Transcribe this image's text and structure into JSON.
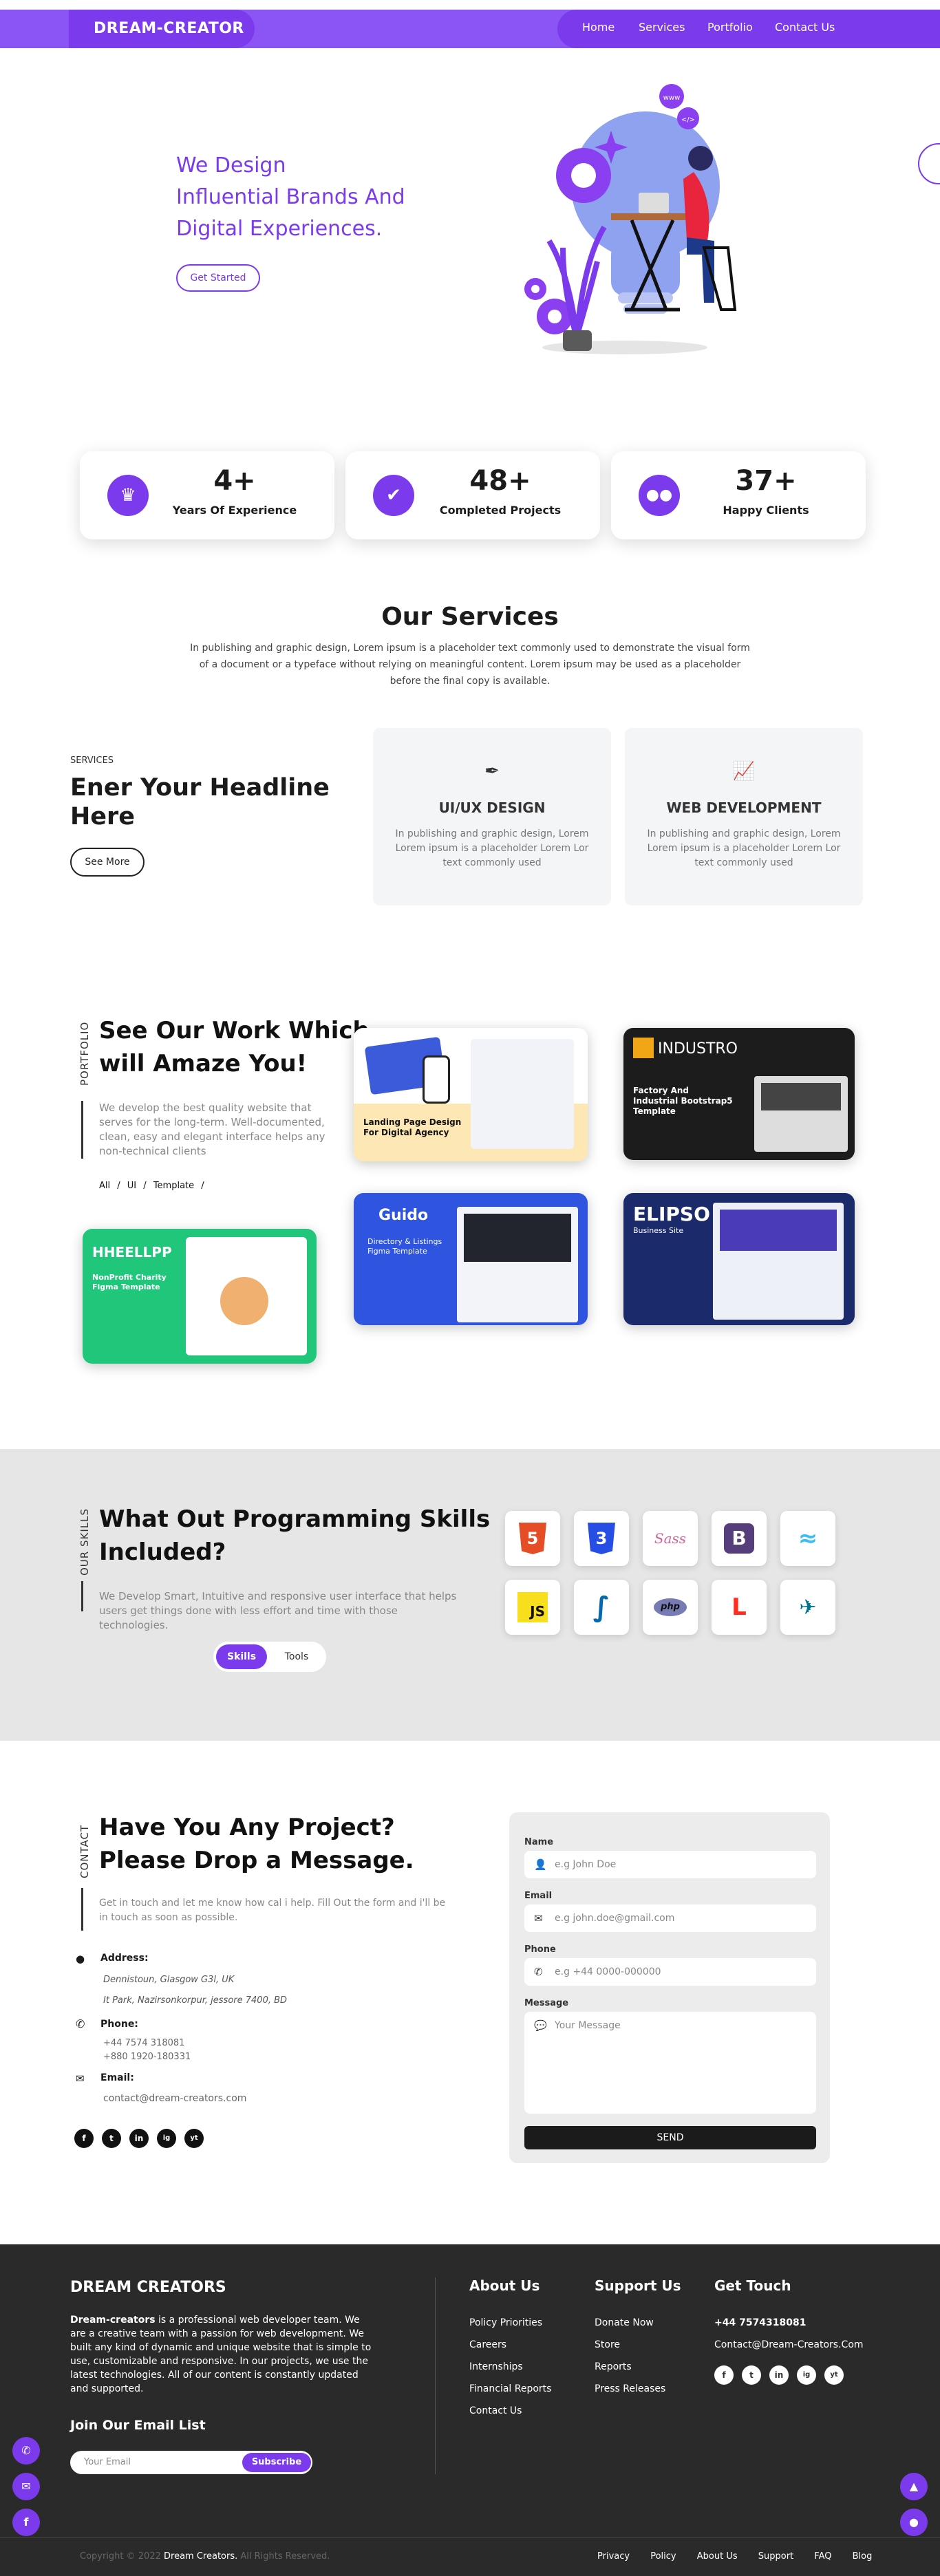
{
  "header": {
    "brand": "DREAM-CREATOR",
    "nav": [
      "Home",
      "Services",
      "Portfolio",
      "Contact Us"
    ]
  },
  "hero": {
    "lines": [
      "We Design",
      "Influential Brands And",
      "Digital Experiences."
    ],
    "cta": "Get Started",
    "bubbles": [
      "www",
      "</>"
    ]
  },
  "stats": [
    {
      "icon": "medal-icon",
      "number": "4+",
      "label": "Years Of Experience"
    },
    {
      "icon": "check-icon",
      "number": "48+",
      "label": "Completed Projects"
    },
    {
      "icon": "users-icon",
      "number": "37+",
      "label": "Happy Clients"
    }
  ],
  "services": {
    "title": "Our Services",
    "description": "In publishing and graphic design, Lorem ipsum is a placeholder text commonly used to demonstrate the visual form of a document or a typeface without relying on meaningful content. Lorem ipsum may be used as a placeholder before the final copy is available.",
    "kicker": "SERVICES",
    "headline": "Ener Your Headline Here",
    "see_more": "See More",
    "items": [
      {
        "icon": "pen-tool-icon",
        "title": "UI/UX DESIGN",
        "text": "In publishing and graphic design, Lorem Lorem ipsum is a placeholder Lorem Lor text commonly used"
      },
      {
        "icon": "chart-line-icon",
        "title": "WEB DEVELOPMENT",
        "text": "In publishing and graphic design, Lorem Lorem ipsum is a placeholder Lorem Lor text commonly used"
      }
    ]
  },
  "portfolio": {
    "vertical": "PORTFOLIO",
    "title_lines": [
      "See Our Work Which",
      "will Amaze You!"
    ],
    "text": "We develop the best quality website that serves for the long-term. Well-documented, clean, easy and elegant interface helps any non-technical clients",
    "filters": [
      "All",
      "UI",
      "Template"
    ],
    "cards": [
      {
        "name": "Landing Page Design For Digital Agency",
        "bg": "#fde7b5"
      },
      {
        "name": "INDUSTRO",
        "sub": "Factory And Industrial Bootstrap5 Template",
        "bg": "#1c1c1c"
      },
      {
        "name": "HHEELLPP",
        "sub": "NonProfit Charity Figma Template",
        "bg": "#20c67a"
      },
      {
        "name": "Guido",
        "sub": "Directory & Listings Figma Template",
        "bg": "#2f55e0"
      },
      {
        "name": "ELIPSO",
        "sub": "Business Site",
        "bg": "#1b2a6b"
      }
    ]
  },
  "skills": {
    "vertical": "OUR SKILLS",
    "title_lines": [
      "What Out Programming Skills",
      "Included?"
    ],
    "text": "We Develop Smart, Intuitive and responsive user interface that helps users get things done with less effort and time with those technologies.",
    "tabs": [
      "Skills",
      "Tools"
    ],
    "icons": [
      {
        "name": "html5-icon",
        "glyph": "5",
        "color": "#e44d26"
      },
      {
        "name": "css3-icon",
        "glyph": "3",
        "color": "#264de4"
      },
      {
        "name": "sass-icon",
        "glyph": "Sass",
        "color": "#cf649a"
      },
      {
        "name": "bootstrap-icon",
        "glyph": "B",
        "color": "#563d7c"
      },
      {
        "name": "tailwind-icon",
        "glyph": "≈",
        "color": "#38bdf8"
      },
      {
        "name": "javascript-icon",
        "glyph": "JS",
        "color": "#f7df1e"
      },
      {
        "name": "jquery-icon",
        "glyph": "∫",
        "color": "#0769ad"
      },
      {
        "name": "php-icon",
        "glyph": "php",
        "color": "#777bb3"
      },
      {
        "name": "laravel-icon",
        "glyph": "L",
        "color": "#ff2d20"
      },
      {
        "name": "mysql-icon",
        "glyph": "✈",
        "color": "#00758f"
      }
    ]
  },
  "contact": {
    "vertical": "CONTACT",
    "title_lines": [
      "Have You Any Project?",
      "Please Drop a Message."
    ],
    "text": "Get in touch and let me know how cal i help. Fill Out the form and i'll be in touch as soon as possible.",
    "address_label": "Address:",
    "address_lines": [
      "Dennistoun, Glasgow G3l, UK",
      "It Park, Nazirsonkorpur, jessore 7400, BD"
    ],
    "phone_label": "Phone:",
    "phones": [
      "+44 7574 318081",
      "+880 1920-180331"
    ],
    "email_label": "Email:",
    "email": "contact@dream-creators.com",
    "socials": [
      "f",
      "t",
      "in",
      "ig",
      "yt"
    ],
    "form": {
      "name_label": "Name",
      "name_placeholder": "e.g John Doe",
      "email_label": "Email",
      "email_placeholder": "e.g john.doe@gmail.com",
      "phone_label": "Phone",
      "phone_placeholder": "e.g +44 0000-000000",
      "message_label": "Message",
      "message_placeholder": "Your Message",
      "send": "SEND"
    }
  },
  "footer": {
    "brand": "DREAM CREATORS",
    "about_bold": "Dream-creators",
    "about": " is a professional web developer team. We are a creative team with a passion for web development. We built any kind of dynamic and unique website that is simple to use, customizable and responsive. In our projects, we use the latest technologies. All of our content is constantly updated and supported.",
    "newsletter_title": "Join Our Email List",
    "newsletter_placeholder": "Your Email",
    "subscribe": "Subscribe",
    "about_us_title": "About Us",
    "about_links": [
      "Policy Priorities",
      "Careers",
      "Internships",
      "Financial Reports",
      "Contact Us"
    ],
    "support_title": "Support Us",
    "support_links": [
      "Donate Now",
      "Store",
      "Reports",
      "Press Releases"
    ],
    "touch_title": "Get Touch",
    "touch_phone": "+44 7574318081",
    "touch_email": "Contact@Dream-Creators.Com",
    "copyright_pre": "Copyright © 2022 ",
    "copyright_brand": "Dream Creators.",
    "copyright_post": " All Rights Reserved.",
    "bottom_links": [
      "Privacy",
      "Policy",
      "About Us",
      "Support",
      "FAQ",
      "Blog"
    ]
  },
  "colors": {
    "accent": "#7c3aed",
    "dark": "#2a2a2a",
    "gray_band": "#e6e6e6"
  }
}
